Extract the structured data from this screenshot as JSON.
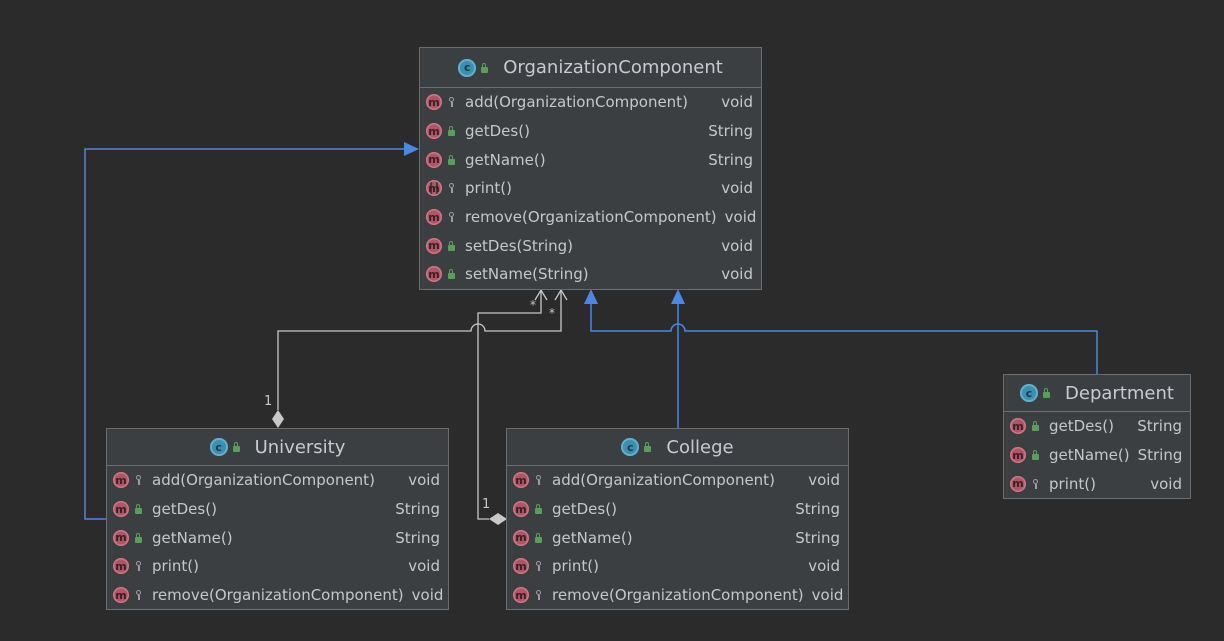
{
  "colors": {
    "background": "#2b2b2b",
    "class_fill": "#3c3f41",
    "class_border": "#6a6d70",
    "inheritance_edge": "#4a88e4",
    "aggregation_edge": "#c8c8c8",
    "method_icon": "#b05566",
    "class_icon": "#3d8fb0",
    "public_lock": "#58a05a"
  },
  "classes": {
    "organization_component": {
      "name": "OrganizationComponent",
      "icon": "class-icon",
      "methods": [
        {
          "visibility": "package",
          "name": "add(OrganizationComponent)",
          "type": "void"
        },
        {
          "visibility": "public",
          "name": "getDes()",
          "type": "String"
        },
        {
          "visibility": "public",
          "name": "getName()",
          "type": "String"
        },
        {
          "visibility": "package",
          "name": "print()",
          "type": "void",
          "abstract": true
        },
        {
          "visibility": "package",
          "name": "remove(OrganizationComponent)",
          "type": "void"
        },
        {
          "visibility": "public",
          "name": "setDes(String)",
          "type": "void"
        },
        {
          "visibility": "public",
          "name": "setName(String)",
          "type": "void"
        }
      ]
    },
    "university": {
      "name": "University",
      "icon": "class-icon",
      "methods": [
        {
          "visibility": "package",
          "name": "add(OrganizationComponent)",
          "type": "void"
        },
        {
          "visibility": "public",
          "name": "getDes()",
          "type": "String"
        },
        {
          "visibility": "public",
          "name": "getName()",
          "type": "String"
        },
        {
          "visibility": "package",
          "name": "print()",
          "type": "void"
        },
        {
          "visibility": "package",
          "name": "remove(OrganizationComponent)",
          "type": "void"
        }
      ]
    },
    "college": {
      "name": "College",
      "icon": "class-icon",
      "methods": [
        {
          "visibility": "package",
          "name": "add(OrganizationComponent)",
          "type": "void"
        },
        {
          "visibility": "public",
          "name": "getDes()",
          "type": "String"
        },
        {
          "visibility": "public",
          "name": "getName()",
          "type": "String"
        },
        {
          "visibility": "package",
          "name": "print()",
          "type": "void"
        },
        {
          "visibility": "package",
          "name": "remove(OrganizationComponent)",
          "type": "void"
        }
      ]
    },
    "department": {
      "name": "Department",
      "icon": "class-icon",
      "methods": [
        {
          "visibility": "public",
          "name": "getDes()",
          "type": "String"
        },
        {
          "visibility": "public",
          "name": "getName()",
          "type": "String"
        },
        {
          "visibility": "package",
          "name": "print()",
          "type": "void"
        }
      ]
    }
  },
  "relations": {
    "university_aggregation_multiplicity": "1",
    "college_aggregation_multiplicity": "1",
    "arrow_end_marker_left": "*",
    "arrow_end_marker_right": "*"
  }
}
